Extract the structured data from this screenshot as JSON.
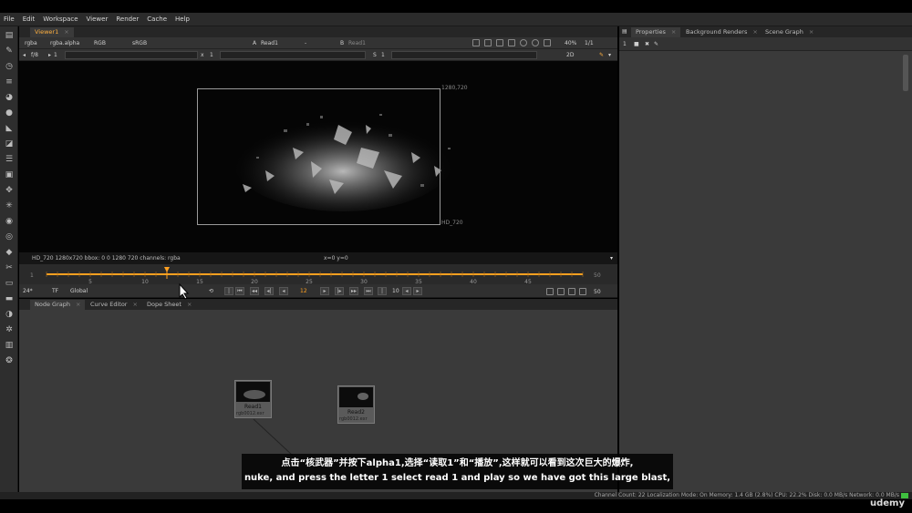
{
  "menu": [
    "File",
    "Edit",
    "Workspace",
    "Viewer",
    "Render",
    "Cache",
    "Help"
  ],
  "viewer": {
    "tab": "Viewer1",
    "row1": {
      "channels": "rgba",
      "alpha": "rgba.alpha",
      "colorspace_label": "RGB",
      "lut": "sRGB",
      "input_a_prefix": "A",
      "input_a": "Read1",
      "input_dash": "-",
      "input_b_prefix": "B",
      "input_b": "Read1",
      "zoom": "40%",
      "ratio": "1/1"
    },
    "row2": {
      "fstop": "f/8",
      "play_step": "1",
      "x_label": "x",
      "x_value": "1",
      "s_label": "S",
      "s_value": "1",
      "view_mode": "2D"
    },
    "frame_label_top": "1280,720",
    "frame_label_bottom": "HD_720",
    "info_left": "HD_720 1280x720   bbox: 0 0 1280 720 channels: rgba",
    "info_center": "x=0 y=0"
  },
  "timeline": {
    "start": 1,
    "end": 50,
    "current_frame": 12,
    "ticks": [
      1,
      5,
      10,
      15,
      20,
      25,
      30,
      35,
      40,
      45,
      50
    ],
    "end_display": "50",
    "start_display": "1"
  },
  "playback": {
    "fps": "24*",
    "tf": "TF",
    "global": "Global",
    "frame_field": "12",
    "increment": "10",
    "end_field": "50"
  },
  "node_graph": {
    "tabs": [
      {
        "label": "Node Graph",
        "active": true
      },
      {
        "label": "Curve Editor",
        "active": false
      },
      {
        "label": "Dope Sheet",
        "active": false
      }
    ],
    "nodes": [
      {
        "label": "Read1",
        "file": "rgb0012.exr"
      },
      {
        "label": "Read2",
        "file": "rgb0012.exr"
      }
    ]
  },
  "properties": {
    "tabs": [
      {
        "label": "Properties",
        "active": true
      },
      {
        "label": "Background Renders",
        "active": false
      },
      {
        "label": "Scene Graph",
        "active": false
      }
    ]
  },
  "status": {
    "text": "Channel Count: 22  Localization Mode: On  Memory: 1.4 GB (2.8%)  CPU: 22.2%  Disk: 0.0 MB/s  Network: 0.0 MB/s"
  },
  "watermark": "udemy",
  "subtitle": {
    "line1": "点击“核武器”并按下alpha1,选择“读取1”和“播放”,这样就可以看到这次巨大的爆炸,",
    "line2": "nuke, and press the letter 1 select read 1 and play so we have got this large blast,"
  },
  "colors": {
    "accent": "#ffa020",
    "background": "#3a3a3a",
    "status_ok": "#3fbf3f"
  }
}
